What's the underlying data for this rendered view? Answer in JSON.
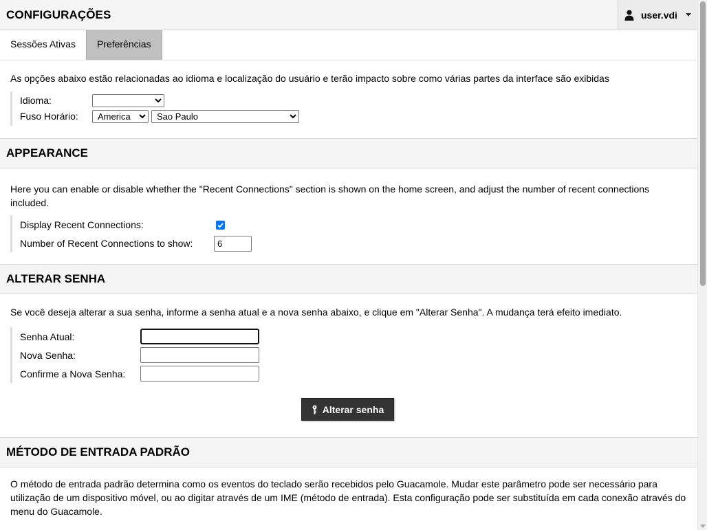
{
  "header": {
    "title": "CONFIGURAÇÕES",
    "username": "user.vdi"
  },
  "tabs": [
    {
      "label": "Sessões Ativas",
      "active": false
    },
    {
      "label": "Preferências",
      "active": true
    }
  ],
  "language_section": {
    "description": "As opções abaixo estão relacionadas ao idioma e localização do usuário e terão impacto sobre como várias partes da interface são exibidas",
    "language_label": "Idioma:",
    "language_value": "",
    "timezone_label": "Fuso Horário:",
    "timezone_region": "America",
    "timezone_city": "Sao Paulo"
  },
  "appearance_section": {
    "title": "APPEARANCE",
    "description": "Here you can enable or disable whether the \"Recent Connections\" section is shown on the home screen, and adjust the number of recent connections included.",
    "display_recent_label": "Display Recent Connections:",
    "display_recent_checked": true,
    "recent_count_label": "Number of Recent Connections to show:",
    "recent_count_value": "6"
  },
  "password_section": {
    "title": "ALTERAR SENHA",
    "description": "Se você deseja alterar a sua senha, informe a senha atual e a nova senha abaixo, e clique em \"Alterar Senha\". A mudança terá efeito imediato.",
    "current_label": "Senha Atual:",
    "new_label": "Nova Senha:",
    "confirm_label": "Confirme a Nova Senha:",
    "submit_label": "Alterar senha"
  },
  "input_method_section": {
    "title": "MÉTODO DE ENTRADA PADRÃO",
    "description": "O método de entrada padrão determina como os eventos do teclado serão recebidos pelo Guacamole. Mudar este parâmetro pode ser necessário para utilização de um dispositivo móvel, ou ao digitar através de um IME (método de entrada). Esta configuração pode ser substituída em cada conexão através do menu do Guacamole."
  },
  "colors": {
    "header_bg": "#f5f5f5",
    "active_tab_bg": "#c0c0c0",
    "button_bg": "#333333",
    "checkbox_accent": "#0075ff"
  }
}
